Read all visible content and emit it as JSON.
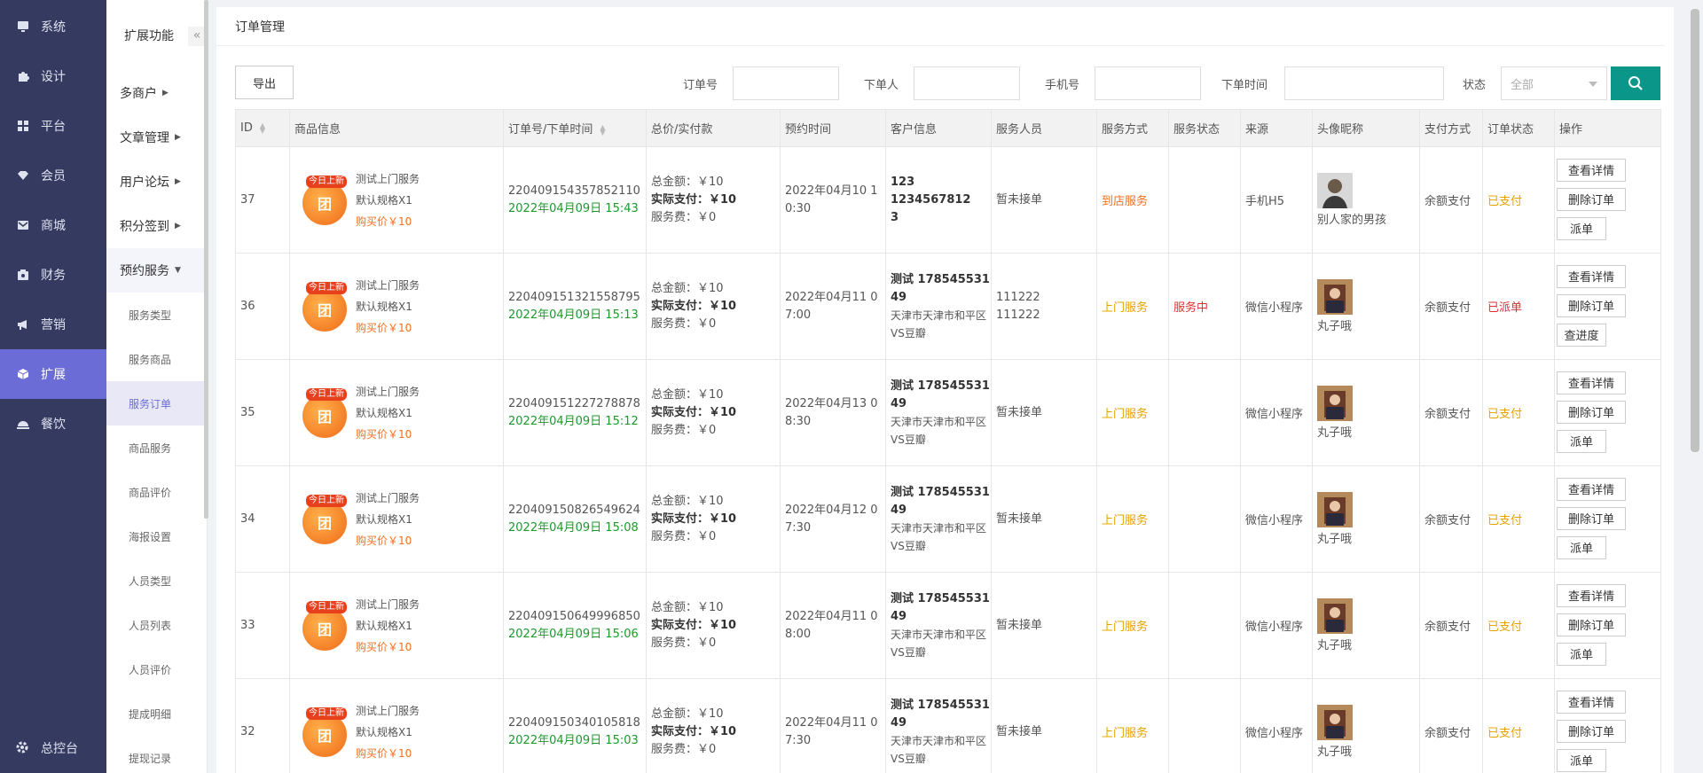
{
  "sidebar": {
    "items": [
      {
        "label": "系统",
        "icon": "monitor-icon"
      },
      {
        "label": "设计",
        "icon": "puzzle-icon"
      },
      {
        "label": "平台",
        "icon": "grid-icon"
      },
      {
        "label": "会员",
        "icon": "diamond-icon"
      },
      {
        "label": "商城",
        "icon": "mail-icon"
      },
      {
        "label": "财务",
        "icon": "wallet-icon"
      },
      {
        "label": "营销",
        "icon": "megaphone-icon"
      },
      {
        "label": "扩展",
        "icon": "cube-icon"
      },
      {
        "label": "餐饮",
        "icon": "cloche-icon"
      }
    ],
    "bottom_label": "总控台"
  },
  "subnav": {
    "title": "扩展功能",
    "collapse_icon": "«",
    "groups": [
      "多商户",
      "文章管理",
      "用户论坛",
      "积分签到",
      "预约服务"
    ],
    "items": [
      "服务类型",
      "服务商品",
      "服务订单",
      "商品服务",
      "商品评价",
      "海报设置",
      "人员类型",
      "人员列表",
      "人员评价",
      "提成明细",
      "提现记录"
    ]
  },
  "page": {
    "title": "订单管理"
  },
  "filters": {
    "export_label": "导出",
    "order_no_label": "订单号",
    "buyer_label": "下单人",
    "phone_label": "手机号",
    "time_label": "下单时间",
    "status_label": "状态",
    "status_value": "全部"
  },
  "table": {
    "headers": [
      "ID",
      "商品信息",
      "订单号/下单时间",
      "总价/实付款",
      "预约时间",
      "客户信息",
      "服务人员",
      "服务方式",
      "服务状态",
      "来源",
      "头像昵称",
      "支付方式",
      "订单状态",
      "操作"
    ],
    "badge": "今日上新",
    "circle_char": "团",
    "rows": [
      {
        "id": "37",
        "product": "测试上门服务",
        "spec": "默认规格X1",
        "price": "购买价￥10",
        "order_no": "220409154357852110",
        "order_time": "2022年04月09日 15:43",
        "total": "总金额：￥10",
        "paid": "实际支付：￥10",
        "fee": "服务费：￥0",
        "appt1": "2022年04月10 1",
        "appt2": "0:30",
        "cust1": "123 1234567812",
        "cust2": "3",
        "cust3": "",
        "cust4": "",
        "staff1": "暂未接单",
        "staff2": "",
        "method": "到店服务",
        "svc_status": "",
        "source": "手机H5",
        "nickname": "别人家的男孩",
        "pay": "余额支付",
        "order_status": "已支付",
        "ops": [
          "查看详情",
          "删除订单",
          "派单"
        ]
      },
      {
        "id": "36",
        "product": "测试上门服务",
        "spec": "默认规格X1",
        "price": "购买价￥10",
        "order_no": "220409151321558795",
        "order_time": "2022年04月09日 15:13",
        "total": "总金额：￥10",
        "paid": "实际支付：￥10",
        "fee": "服务费：￥0",
        "appt1": "2022年04月11 0",
        "appt2": "7:00",
        "cust1": "测试 178545531",
        "cust2": "49",
        "cust3": "天津市天津市和平区",
        "cust4": "VS豆瓣",
        "staff1": "111222",
        "staff2": "111222",
        "method": "上门服务",
        "svc_status": "服务中",
        "source": "微信小程序",
        "nickname": "丸子哦",
        "pay": "余额支付",
        "order_status": "已派单",
        "ops": [
          "查看详情",
          "删除订单",
          "查进度"
        ]
      },
      {
        "id": "35",
        "product": "测试上门服务",
        "spec": "默认规格X1",
        "price": "购买价￥10",
        "order_no": "220409151227278878",
        "order_time": "2022年04月09日 15:12",
        "total": "总金额：￥10",
        "paid": "实际支付：￥10",
        "fee": "服务费：￥0",
        "appt1": "2022年04月13 0",
        "appt2": "8:30",
        "cust1": "测试 178545531",
        "cust2": "49",
        "cust3": "天津市天津市和平区",
        "cust4": "VS豆瓣",
        "staff1": "暂未接单",
        "staff2": "",
        "method": "上门服务",
        "svc_status": "",
        "source": "微信小程序",
        "nickname": "丸子哦",
        "pay": "余额支付",
        "order_status": "已支付",
        "ops": [
          "查看详情",
          "删除订单",
          "派单"
        ]
      },
      {
        "id": "34",
        "product": "测试上门服务",
        "spec": "默认规格X1",
        "price": "购买价￥10",
        "order_no": "220409150826549624",
        "order_time": "2022年04月09日 15:08",
        "total": "总金额：￥10",
        "paid": "实际支付：￥10",
        "fee": "服务费：￥0",
        "appt1": "2022年04月12 0",
        "appt2": "7:30",
        "cust1": "测试 178545531",
        "cust2": "49",
        "cust3": "天津市天津市和平区",
        "cust4": "VS豆瓣",
        "staff1": "暂未接单",
        "staff2": "",
        "method": "上门服务",
        "svc_status": "",
        "source": "微信小程序",
        "nickname": "丸子哦",
        "pay": "余额支付",
        "order_status": "已支付",
        "ops": [
          "查看详情",
          "删除订单",
          "派单"
        ]
      },
      {
        "id": "33",
        "product": "测试上门服务",
        "spec": "默认规格X1",
        "price": "购买价￥10",
        "order_no": "220409150649996850",
        "order_time": "2022年04月09日 15:06",
        "total": "总金额：￥10",
        "paid": "实际支付：￥10",
        "fee": "服务费：￥0",
        "appt1": "2022年04月11 0",
        "appt2": "8:00",
        "cust1": "测试 178545531",
        "cust2": "49",
        "cust3": "天津市天津市和平区",
        "cust4": "VS豆瓣",
        "staff1": "暂未接单",
        "staff2": "",
        "method": "上门服务",
        "svc_status": "",
        "source": "微信小程序",
        "nickname": "丸子哦",
        "pay": "余额支付",
        "order_status": "已支付",
        "ops": [
          "查看详情",
          "删除订单",
          "派单"
        ]
      },
      {
        "id": "32",
        "product": "测试上门服务",
        "spec": "默认规格X1",
        "price": "购买价￥10",
        "order_no": "220409150340105818",
        "order_time": "2022年04月09日 15:03",
        "total": "总金额：￥10",
        "paid": "实际支付：￥10",
        "fee": "服务费：￥0",
        "appt1": "2022年04月11 0",
        "appt2": "7:30",
        "cust1": "测试 178545531",
        "cust2": "49",
        "cust3": "天津市天津市和平区",
        "cust4": "VS豆瓣",
        "staff1": "暂未接单",
        "staff2": "",
        "method": "上门服务",
        "svc_status": "",
        "source": "微信小程序",
        "nickname": "丸子哦",
        "pay": "余额支付",
        "order_status": "已支付",
        "ops": [
          "查看详情",
          "删除订单",
          "派单"
        ]
      }
    ]
  },
  "colors": {
    "sidebar": "#353a60",
    "active": "#6c6cd6",
    "search": "#0a9688",
    "paid": "#e6a300",
    "dispatched": "#e03030",
    "time": "#1a9a2a"
  }
}
